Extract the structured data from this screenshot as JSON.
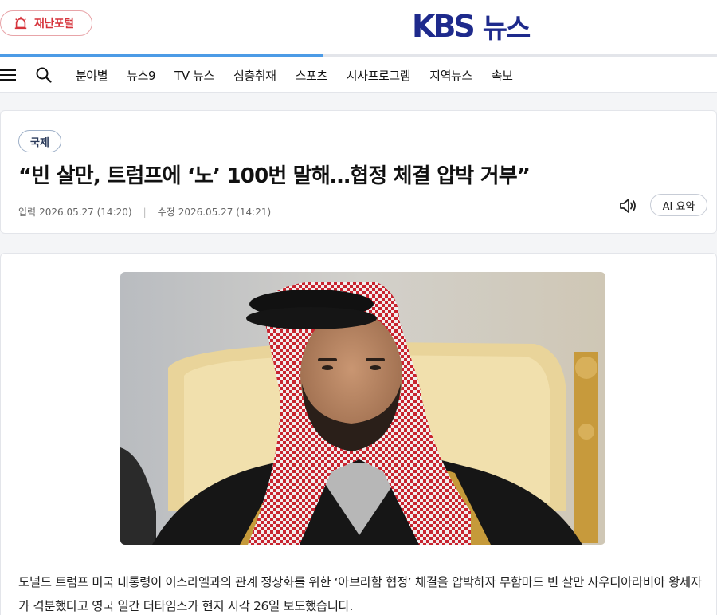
{
  "header": {
    "disaster_portal_label": "재난포털",
    "logo_kbs": "KBS",
    "logo_news": "뉴스",
    "reading_progress": 0.45
  },
  "nav": {
    "items": [
      "분야별",
      "뉴스9",
      "TV 뉴스",
      "심층취재",
      "스포츠",
      "시사프로그램",
      "지역뉴스",
      "속보"
    ]
  },
  "article": {
    "category": "국제",
    "headline": "“빈 살만, 트럼프에 ‘노’ 100번 말해…협정 체결 압박 거부”",
    "input_label": "입력",
    "input_date": "2026.05.27 (14:20)",
    "modified_label": "수정",
    "modified_date": "2026.05.27 (14:21)",
    "ai_summary_label": "AI 요약",
    "body": "도널드 트럼프 미국 대통령이 이스라엘과의 관계 정상화를 위한 ‘아브라함 협정’ 체결을 압박하자 무함마드 빈 살만 사우디아라비아 왕세자가 격분했다고 영국 일간 더타임스가 현지 시각 26일 보도했습니다."
  },
  "colors": {
    "brand_blue": "#1e2a8c",
    "disaster_red": "#d6333b",
    "progress_blue": "#4c9be6"
  }
}
